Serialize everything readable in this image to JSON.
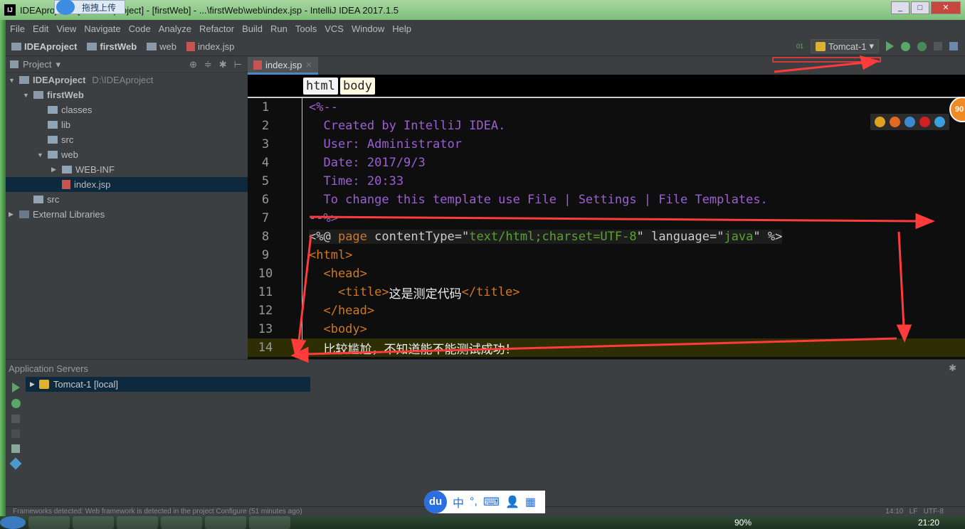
{
  "window": {
    "title": "IDEAproject - [D:\\IDEAproject] - [firstWeb] - ...\\firstWeb\\web\\index.jsp - IntelliJ IDEA 2017.1.5",
    "upload_label": "拖拽上传",
    "controls": [
      "_",
      "□",
      "✕"
    ]
  },
  "menu": [
    "File",
    "Edit",
    "View",
    "Navigate",
    "Code",
    "Analyze",
    "Refactor",
    "Build",
    "Run",
    "Tools",
    "VCS",
    "Window",
    "Help"
  ],
  "nav": {
    "crumbs": [
      "IDEAproject",
      "firstWeb",
      "web",
      "index.jsp"
    ],
    "run_config": "Tomcat-1"
  },
  "project": {
    "title": "Project",
    "tree": [
      {
        "label": "IDEAproject",
        "path": "D:\\IDEAproject",
        "arrow": "▼",
        "indent": 0,
        "bold": true,
        "icon": "module"
      },
      {
        "label": "firstWeb",
        "arrow": "▼",
        "indent": 1,
        "bold": true,
        "icon": "module"
      },
      {
        "label": "classes",
        "arrow": "",
        "indent": 2,
        "icon": "folder"
      },
      {
        "label": "lib",
        "arrow": "",
        "indent": 2,
        "icon": "folder"
      },
      {
        "label": "src",
        "arrow": "",
        "indent": 2,
        "icon": "folder"
      },
      {
        "label": "web",
        "arrow": "▼",
        "indent": 2,
        "icon": "folder"
      },
      {
        "label": "WEB-INF",
        "arrow": "▶",
        "indent": 3,
        "icon": "folder"
      },
      {
        "label": "index.jsp",
        "arrow": "",
        "indent": 3,
        "icon": "jsp",
        "selected": true
      },
      {
        "label": "src",
        "arrow": "",
        "indent": 1,
        "icon": "folder"
      },
      {
        "label": "External Libraries",
        "arrow": "▶",
        "indent": 0,
        "icon": "libraries"
      }
    ]
  },
  "editor": {
    "tab": "index.jsp",
    "breadcrumbs": [
      "html",
      "body"
    ],
    "badge": "90",
    "lines": [
      [
        [
          "cm",
          "<%--"
        ]
      ],
      [
        [
          "cm",
          "  Created by IntelliJ IDEA."
        ]
      ],
      [
        [
          "cm",
          "  User: Administrator"
        ]
      ],
      [
        [
          "cm",
          "  Date: 2017/9/3"
        ]
      ],
      [
        [
          "cm",
          "  Time: 20:33"
        ]
      ],
      [
        [
          "cm",
          "  To change this template use File | Settings | File Templates."
        ]
      ],
      [
        [
          "cm",
          "--%>"
        ]
      ],
      [
        [
          "dir tx",
          "<%@ "
        ],
        [
          "dir tg",
          "page "
        ],
        [
          "dir tx",
          "contentType=\""
        ],
        [
          "dir st",
          "text/html;charset=UTF-8"
        ],
        [
          "dir tx",
          "\" language=\""
        ],
        [
          "dir st",
          "java"
        ],
        [
          "dir tx",
          "\" %>"
        ]
      ],
      [
        [
          "tg",
          "<html>"
        ]
      ],
      [
        [
          "tg",
          "  <head>"
        ]
      ],
      [
        [
          "tg",
          "    <title>"
        ],
        [
          "wh",
          "这是测定代码"
        ],
        [
          "tg",
          "</title>"
        ]
      ],
      [
        [
          "tg",
          "  </head>"
        ]
      ],
      [
        [
          "tg",
          "  <body>"
        ]
      ],
      [
        [
          "wh",
          "  比较尴尬，不知道能不能测试成功！"
        ]
      ]
    ],
    "current_line": 14
  },
  "app_servers": {
    "title": "Application Servers",
    "server": "Tomcat-1 [local]"
  },
  "status": {
    "message": "Frameworks detected: Web framework is detected in the project Configure (51 minutes ago)",
    "position": "14:10",
    "line_sep": "LF",
    "encoding": "UTF-8"
  },
  "ime": {
    "logo": "du",
    "items": [
      "中",
      "°,",
      "⌨",
      "👤",
      "▦"
    ]
  },
  "taskbar": {
    "zoom": "90%",
    "clock": "21:20"
  },
  "colors": {
    "comment": "#9c5fd4",
    "tag": "#d2771e",
    "string": "#59a32a",
    "selection": "#0d293e",
    "annotation": "#ff3b3b"
  }
}
